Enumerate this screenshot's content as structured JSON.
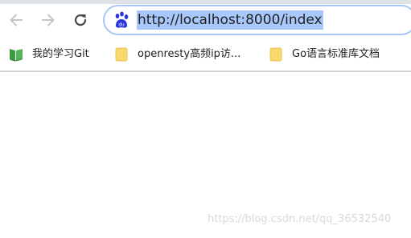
{
  "address_bar": {
    "url": "http://localhost:8000/index",
    "site_icon": "baidu-paw-icon"
  },
  "navigation": {
    "back_icon": "arrow-left-icon",
    "forward_icon": "arrow-right-icon",
    "reload_icon": "reload-icon"
  },
  "bookmarks": [
    {
      "label": "我的学习Git",
      "icon": "green-book-icon"
    },
    {
      "label": "openresty高频ip访...",
      "icon": "folder-icon"
    },
    {
      "label": "Go语言标准库文档",
      "icon": "folder-icon"
    }
  ],
  "watermark": {
    "text": "https://blog.csdn.net/qq_36532540"
  },
  "colors": {
    "url_selection": "#a8c7fa",
    "folder": "#f9d86e",
    "bookmark_green": "#3c9a40",
    "baidu_blue": "#2932e1",
    "nav_icon": "#5f6368"
  }
}
